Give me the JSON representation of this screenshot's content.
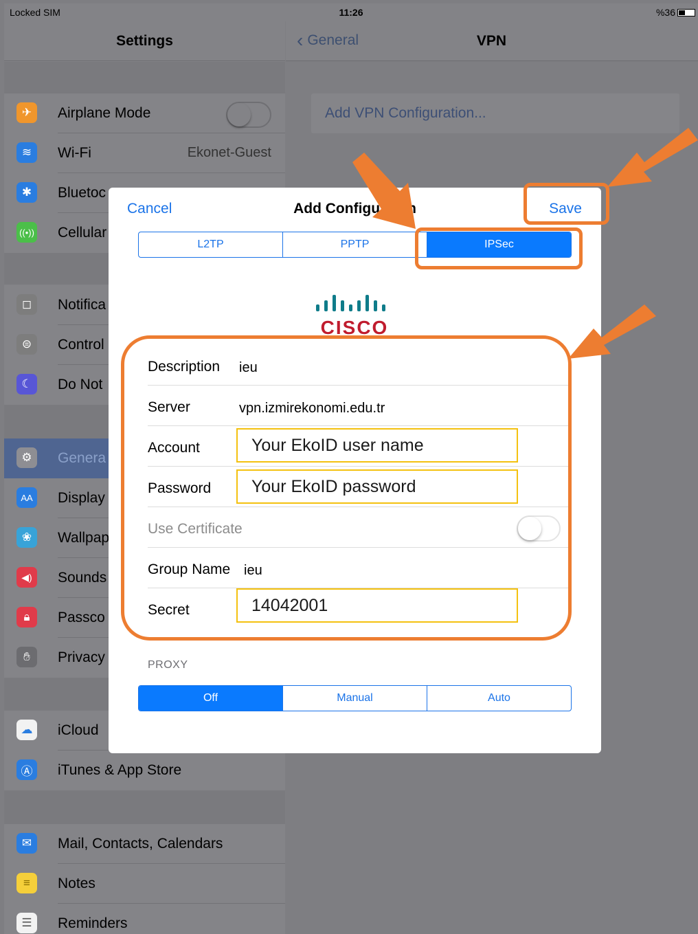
{
  "status_bar": {
    "carrier": "Locked SIM",
    "time": "11:26",
    "battery": "%36"
  },
  "settings": {
    "title": "Settings",
    "items": [
      {
        "label": "Airplane Mode",
        "icon": "airplane-icon",
        "color": "#f0962c"
      },
      {
        "label": "Wi-Fi",
        "value": "Ekonet-Guest",
        "icon": "wifi-icon",
        "color": "#2a7de0"
      },
      {
        "label": "Bluetoc",
        "icon": "bluetooth-icon",
        "color": "#2a7de0"
      },
      {
        "label": "Cellular",
        "icon": "cellular-icon",
        "color": "#4bbf49"
      },
      {
        "label": "Notifica",
        "icon": "notifications-icon",
        "color": "#7d7d7d"
      },
      {
        "label": "Control",
        "icon": "control-center-icon",
        "color": "#7d7d7d"
      },
      {
        "label": "Do Not",
        "icon": "moon-icon",
        "color": "#5856d6"
      },
      {
        "label": "Genera",
        "icon": "gear-icon",
        "color": "#8e8e93"
      },
      {
        "label": "Display",
        "icon": "display-icon",
        "color": "#2a7de0"
      },
      {
        "label": "Wallpap",
        "icon": "wallpaper-icon",
        "color": "#38a3d8"
      },
      {
        "label": "Sounds",
        "icon": "sounds-icon",
        "color": "#e03b4a"
      },
      {
        "label": "Passco",
        "icon": "lock-icon",
        "color": "#e03b4a"
      },
      {
        "label": "Privacy",
        "icon": "hand-icon",
        "color": "#6c6c70"
      },
      {
        "label": "iCloud",
        "icon": "cloud-icon",
        "color": "#ffffff"
      },
      {
        "label": "iTunes & App Store",
        "icon": "app-store-icon",
        "color": "#2a7de0"
      },
      {
        "label": "Mail, Contacts, Calendars",
        "icon": "mail-icon",
        "color": "#2a7de0"
      },
      {
        "label": "Notes",
        "icon": "notes-icon",
        "color": "#f5cf3a"
      },
      {
        "label": "Reminders",
        "icon": "reminders-icon",
        "color": "#ffffff"
      }
    ]
  },
  "vpn": {
    "back_label": "General",
    "title": "VPN",
    "add_config": "Add VPN Configuration..."
  },
  "dialog": {
    "cancel": "Cancel",
    "title": "Add Configu",
    "title_tail": "n",
    "save": "Save",
    "types": [
      "L2TP",
      "PPTP",
      "IPSec"
    ],
    "selected_type": "IPSec",
    "logo_text": "CISCO",
    "fields": {
      "description_label": "Description",
      "description_value": "ieu",
      "server_label": "Server",
      "server_value": "vpn.izmirekonomi.edu.tr",
      "account_label": "Account",
      "account_value": "Your EkoID user name",
      "password_label": "Password",
      "password_value": "Your EkoID password",
      "certificate_label": "Use Certificate",
      "group_label": "Group Name",
      "group_value": "ieu",
      "secret_label": "Secret",
      "secret_value": "14042001"
    },
    "proxy_header": "PROXY",
    "proxy_options": [
      "Off",
      "Manual",
      "Auto"
    ],
    "proxy_selected": "Off"
  },
  "annotation_color": "#ed7d31"
}
